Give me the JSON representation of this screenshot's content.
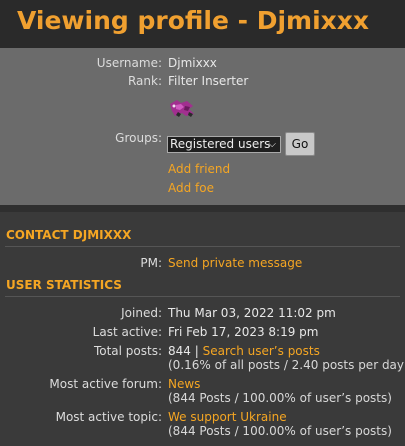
{
  "page": {
    "title": "Viewing profile - Djmixxx"
  },
  "profile": {
    "username_label": "Username:",
    "username": "Djmixxx",
    "rank_label": "Rank:",
    "rank": "Filter Inserter",
    "groups_label": "Groups:",
    "groups_selected": "Registered users",
    "go_label": "Go",
    "add_friend": "Add friend",
    "add_foe": "Add foe"
  },
  "contact": {
    "heading": "CONTACT DJMIXXX",
    "pm_label": "PM:",
    "pm_link": "Send private message"
  },
  "stats": {
    "heading": "USER STATISTICS",
    "joined_label": "Joined:",
    "joined": "Thu Mar 03, 2022 11:02 pm",
    "last_active_label": "Last active:",
    "last_active": "Fri Feb 17, 2023 8:19 pm",
    "total_posts_label": "Total posts:",
    "total_posts": "844 |",
    "search_posts": "Search user’s posts",
    "total_posts_detail": "(0.16% of all posts / 2.40 posts per day)",
    "active_forum_label": "Most active forum:",
    "active_forum": "News",
    "active_forum_detail": "(844 Posts / 100.00% of user’s posts)",
    "active_topic_label": "Most active topic:",
    "active_topic": "We support Ukraine",
    "active_topic_detail": "(844 Posts / 100.00% of user’s posts)"
  },
  "colors": {
    "accent": "#f5a623",
    "title": "#f0a030",
    "panel": "#6b6b6b",
    "background": "#3a3a3a"
  },
  "icons": {
    "rank_image": "rank-badge-icon",
    "dropdown": "chevron-down-icon"
  }
}
